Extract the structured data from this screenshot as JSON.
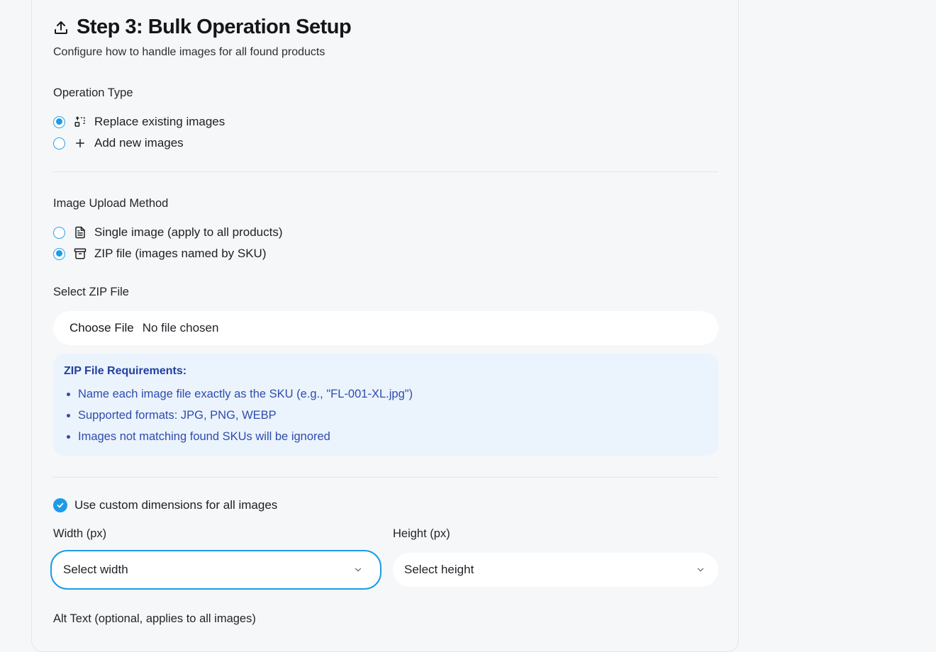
{
  "header": {
    "title": "Step 3: Bulk Operation Setup",
    "subtitle": "Configure how to handle images for all found products",
    "icon": "upload-icon"
  },
  "operation_type": {
    "label": "Operation Type",
    "options": [
      {
        "label": "Replace existing images",
        "icon": "replace-icon",
        "checked": true
      },
      {
        "label": "Add new images",
        "icon": "plus-icon",
        "checked": false
      }
    ]
  },
  "upload_method": {
    "label": "Image Upload Method",
    "options": [
      {
        "label": "Single image (apply to all products)",
        "icon": "file-text-icon",
        "checked": false
      },
      {
        "label": "ZIP file (images named by SKU)",
        "icon": "archive-icon",
        "checked": true
      }
    ]
  },
  "zip_file": {
    "label": "Select ZIP File",
    "button_label": "Choose File",
    "status": "No file chosen"
  },
  "requirements": {
    "title": "ZIP File Requirements:",
    "items": [
      "Name each image file exactly as the SKU (e.g., \"FL-001-XL.jpg\")",
      "Supported formats: JPG, PNG, WEBP",
      "Images not matching found SKUs will be ignored"
    ]
  },
  "dimensions": {
    "checkbox_label": "Use custom dimensions for all images",
    "checked": true,
    "width_label": "Width (px)",
    "width_placeholder": "Select width",
    "height_label": "Height (px)",
    "height_placeholder": "Select height"
  },
  "alt_text": {
    "label": "Alt Text (optional, applies to all images)"
  },
  "colors": {
    "accent": "#1d9be6",
    "info_bg": "#ebf3fd",
    "info_text": "#2f4cad"
  }
}
